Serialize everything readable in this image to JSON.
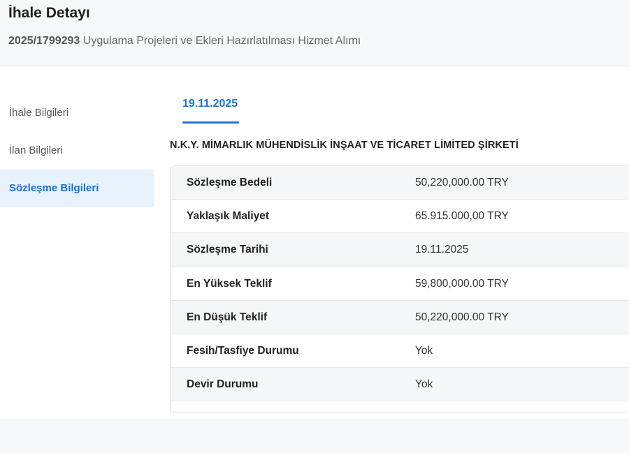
{
  "header": {
    "title": "İhale Detayı",
    "code": "2025/1799293",
    "description": "Uygulama Projeleri ve Ekleri Hazırlatılması Hizmet Alımı"
  },
  "sidebar": {
    "items": [
      {
        "label": "İhale Bilgileri",
        "active": false
      },
      {
        "label": "İlan Bilgileri",
        "active": false
      },
      {
        "label": "Sözleşme Bilgileri",
        "active": true
      }
    ]
  },
  "tabs": [
    {
      "label": "19.11.2025",
      "active": true
    }
  ],
  "company": "N.K.Y. MİMARLIK MÜHENDİSLİK İNŞAAT VE TİCARET LİMİTED ŞİRKETİ",
  "details": [
    {
      "label": "Sözleşme Bedeli",
      "value": "50,220,000.00 TRY"
    },
    {
      "label": "Yaklaşık Maliyet",
      "value": "65.915.000,00 TRY"
    },
    {
      "label": "Sözleşme Tarihi",
      "value": "19.11.2025"
    },
    {
      "label": "En Yüksek Teklif",
      "value": "59,800,000.00 TRY"
    },
    {
      "label": "En Düşük Teklif",
      "value": "50,220,000.00 TRY"
    },
    {
      "label": "Fesih/Tasfiye Durumu",
      "value": "Yok"
    },
    {
      "label": "Devir Durumu",
      "value": "Yok"
    }
  ],
  "colors": {
    "accent": "#1a73d9",
    "active_bg": "#e8f2fd"
  }
}
